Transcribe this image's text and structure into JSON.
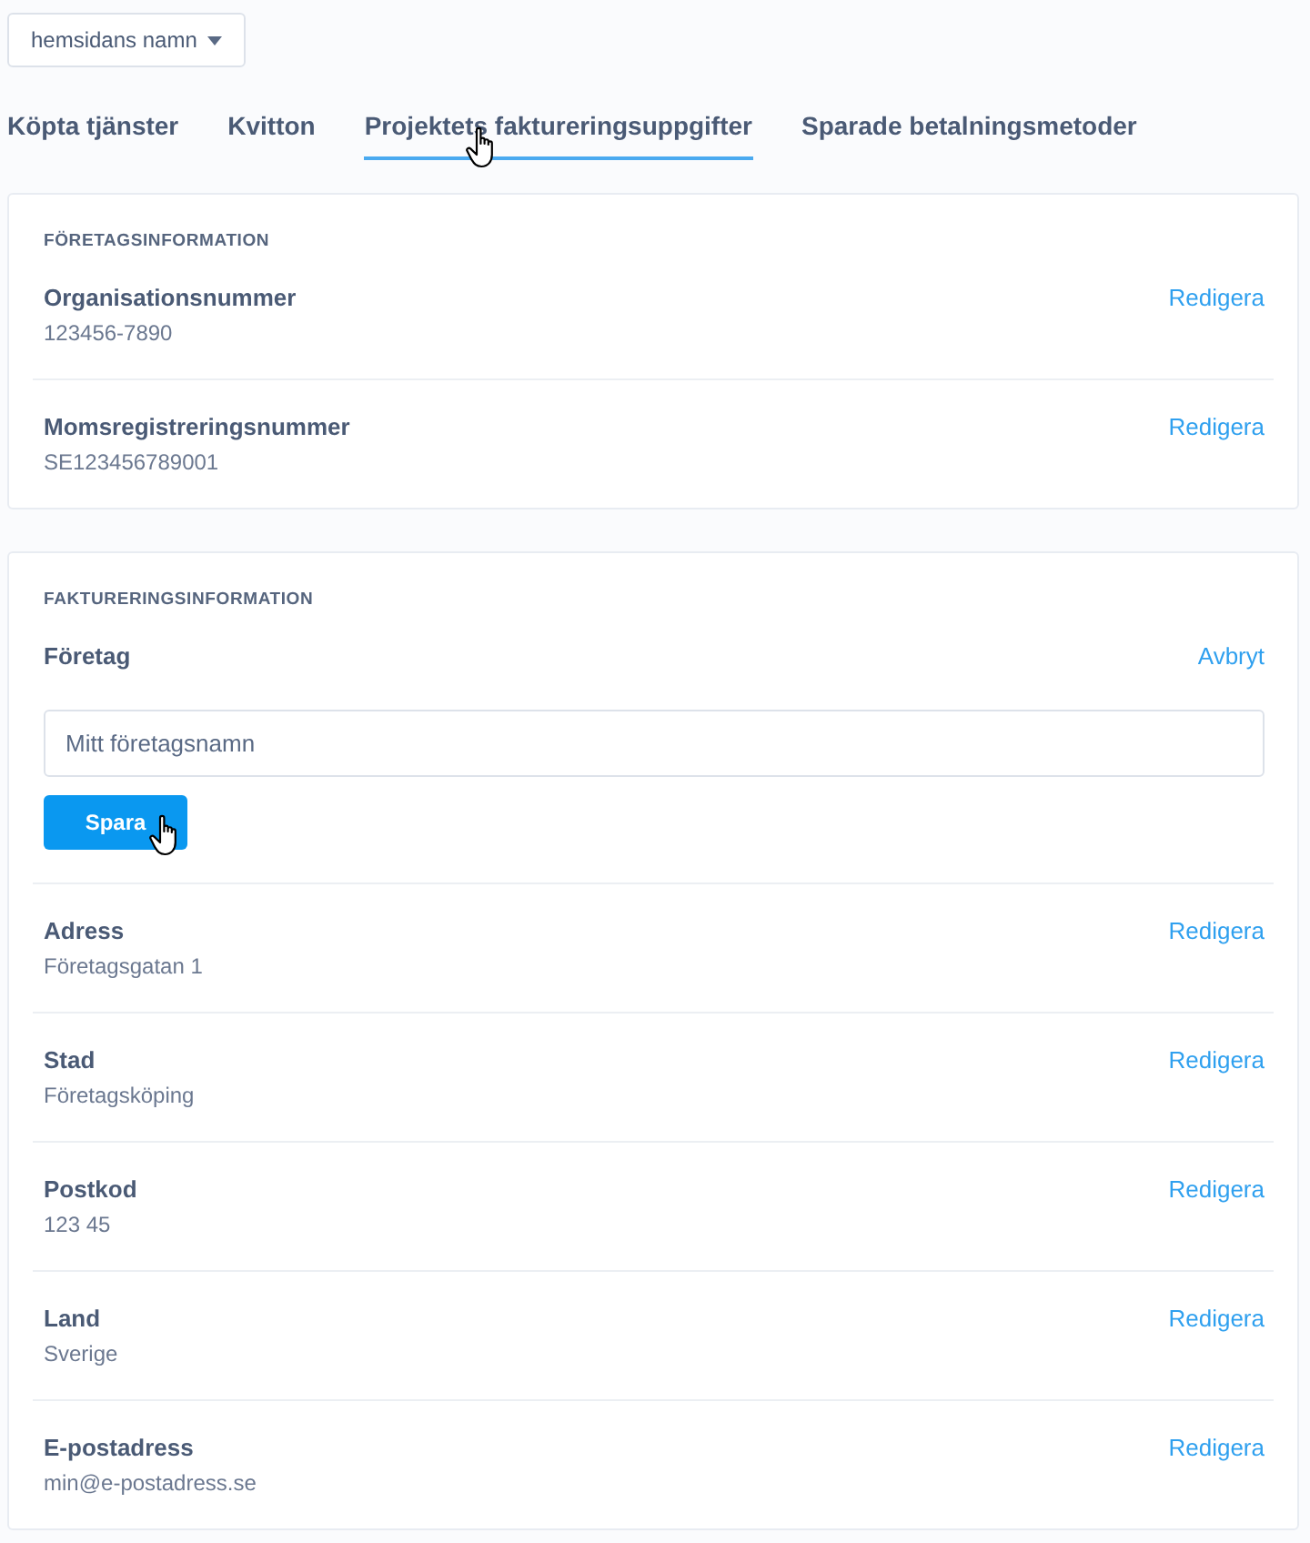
{
  "site_selector": {
    "label": "hemsidans namn"
  },
  "tabs": [
    {
      "label": "Köpta tjänster",
      "selected": false
    },
    {
      "label": "Kvitton",
      "selected": false
    },
    {
      "label": "Projektets faktureringsuppgifter",
      "selected": true
    },
    {
      "label": "Sparade betalningsmetoder",
      "selected": false
    }
  ],
  "sections": [
    {
      "heading": "FÖRETAGSINFORMATION",
      "rows": [
        {
          "kind": "display",
          "label": "Organisationsnummer",
          "value": "123456-7890",
          "action": "Redigera"
        },
        {
          "kind": "display",
          "label": "Momsregistreringsnummer",
          "value": "SE123456789001",
          "action": "Redigera"
        }
      ]
    },
    {
      "heading": "FAKTURERINGSINFORMATION",
      "rows": [
        {
          "kind": "edit",
          "label": "Företag",
          "value": "Mitt företagsnamn",
          "action": "Avbryt",
          "button": "Spara"
        },
        {
          "kind": "display",
          "label": "Adress",
          "value": "Företagsgatan 1",
          "action": "Redigera"
        },
        {
          "kind": "display",
          "label": "Stad",
          "value": "Företagsköping",
          "action": "Redigera"
        },
        {
          "kind": "display",
          "label": "Postkod",
          "value": "123 45",
          "action": "Redigera"
        },
        {
          "kind": "display",
          "label": "Land",
          "value": "Sverige",
          "action": "Redigera"
        },
        {
          "kind": "display",
          "label": "E-postadress",
          "value": "min@e-postadress.se",
          "action": "Redigera"
        }
      ]
    }
  ]
}
